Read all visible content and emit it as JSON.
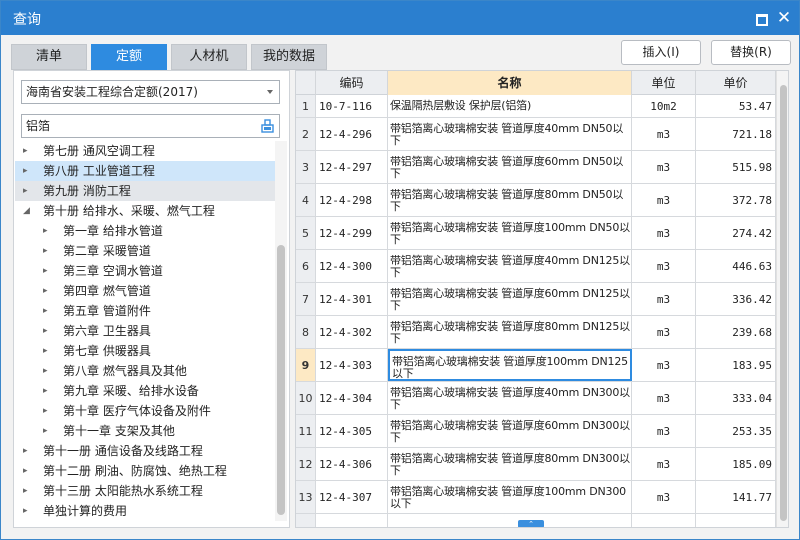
{
  "window": {
    "title": "查询",
    "maximize_icon": "maximize-icon",
    "close_icon": "close-icon",
    "close_glyph": "✕"
  },
  "tabs": [
    {
      "label": "清单",
      "active": false
    },
    {
      "label": "定额",
      "active": true
    },
    {
      "label": "人材机",
      "active": false
    },
    {
      "label": "我的数据",
      "active": false
    }
  ],
  "buttons": {
    "insert": "插入(I)",
    "replace": "替换(R)"
  },
  "left": {
    "library_select": "海南省安装工程综合定额(2017)",
    "search_value": "铝箔",
    "tree": [
      {
        "label": "第七册 通风空调工程",
        "level": 0,
        "arrow": "▸",
        "state": ""
      },
      {
        "label": "第八册 工业管道工程",
        "level": 0,
        "arrow": "▸",
        "state": "sel"
      },
      {
        "label": "第九册 消防工程",
        "level": 0,
        "arrow": "▸",
        "state": "hl"
      },
      {
        "label": "第十册 给排水、采暖、燃气工程",
        "level": 0,
        "arrow": "◢",
        "state": ""
      },
      {
        "label": "第一章 给排水管道",
        "level": 1,
        "arrow": "▸",
        "state": ""
      },
      {
        "label": "第二章 采暖管道",
        "level": 1,
        "arrow": "▸",
        "state": ""
      },
      {
        "label": "第三章 空调水管道",
        "level": 1,
        "arrow": "▸",
        "state": ""
      },
      {
        "label": "第四章 燃气管道",
        "level": 1,
        "arrow": "▸",
        "state": ""
      },
      {
        "label": "第五章 管道附件",
        "level": 1,
        "arrow": "▸",
        "state": ""
      },
      {
        "label": "第六章 卫生器具",
        "level": 1,
        "arrow": "▸",
        "state": ""
      },
      {
        "label": "第七章 供暖器具",
        "level": 1,
        "arrow": "▸",
        "state": ""
      },
      {
        "label": "第八章 燃气器具及其他",
        "level": 1,
        "arrow": "▸",
        "state": ""
      },
      {
        "label": "第九章 采暖、给排水设备",
        "level": 1,
        "arrow": "▸",
        "state": ""
      },
      {
        "label": "第十章 医疗气体设备及附件",
        "level": 1,
        "arrow": "▸",
        "state": ""
      },
      {
        "label": "第十一章 支架及其他",
        "level": 1,
        "arrow": "▸",
        "state": ""
      },
      {
        "label": "第十一册 通信设备及线路工程",
        "level": 0,
        "arrow": "▸",
        "state": ""
      },
      {
        "label": "第十二册 刷油、防腐蚀、绝热工程",
        "level": 0,
        "arrow": "▸",
        "state": ""
      },
      {
        "label": "第十三册 太阳能热水系统工程",
        "level": 0,
        "arrow": "▸",
        "state": ""
      },
      {
        "label": "单独计算的费用",
        "level": 0,
        "arrow": "▸",
        "state": ""
      }
    ]
  },
  "grid": {
    "headers": {
      "code": "编码",
      "name": "名称",
      "unit": "单位",
      "price": "单价"
    },
    "current_row": 9,
    "rows": [
      {
        "idx": "1",
        "code": "10-7-116",
        "name": "保温隔热层敷设 保护层(铝箔)",
        "unit": "10m2",
        "price": "53.47"
      },
      {
        "idx": "2",
        "code": "12-4-296",
        "name": "带铝箔离心玻璃棉安装 管道厚度40mm DN50以下",
        "unit": "m3",
        "price": "721.18"
      },
      {
        "idx": "3",
        "code": "12-4-297",
        "name": "带铝箔离心玻璃棉安装 管道厚度60mm DN50以下",
        "unit": "m3",
        "price": "515.98"
      },
      {
        "idx": "4",
        "code": "12-4-298",
        "name": "带铝箔离心玻璃棉安装 管道厚度80mm DN50以下",
        "unit": "m3",
        "price": "372.78"
      },
      {
        "idx": "5",
        "code": "12-4-299",
        "name": "带铝箔离心玻璃棉安装 管道厚度100mm DN50以下",
        "unit": "m3",
        "price": "274.42"
      },
      {
        "idx": "6",
        "code": "12-4-300",
        "name": "带铝箔离心玻璃棉安装 管道厚度40mm DN125以下",
        "unit": "m3",
        "price": "446.63"
      },
      {
        "idx": "7",
        "code": "12-4-301",
        "name": "带铝箔离心玻璃棉安装 管道厚度60mm DN125以下",
        "unit": "m3",
        "price": "336.42"
      },
      {
        "idx": "8",
        "code": "12-4-302",
        "name": "带铝箔离心玻璃棉安装 管道厚度80mm DN125以下",
        "unit": "m3",
        "price": "239.68"
      },
      {
        "idx": "9",
        "code": "12-4-303",
        "name": "带铝箔离心玻璃棉安装 管道厚度100mm DN125以下",
        "unit": "m3",
        "price": "183.95"
      },
      {
        "idx": "10",
        "code": "12-4-304",
        "name": "带铝箔离心玻璃棉安装 管道厚度40mm DN300以下",
        "unit": "m3",
        "price": "333.04"
      },
      {
        "idx": "11",
        "code": "12-4-305",
        "name": "带铝箔离心玻璃棉安装 管道厚度60mm DN300以下",
        "unit": "m3",
        "price": "253.35"
      },
      {
        "idx": "12",
        "code": "12-4-306",
        "name": "带铝箔离心玻璃棉安装 管道厚度80mm DN300以下",
        "unit": "m3",
        "price": "185.09"
      },
      {
        "idx": "13",
        "code": "12-4-307",
        "name": "带铝箔离心玻璃棉安装 管道厚度100mm DN300以下",
        "unit": "m3",
        "price": "141.77"
      }
    ]
  },
  "colors": {
    "titlebar": "#2b7fcf",
    "accent": "#2e8be0",
    "name_header": "#fde9c4",
    "selected_tree": "#cfe6fa"
  }
}
